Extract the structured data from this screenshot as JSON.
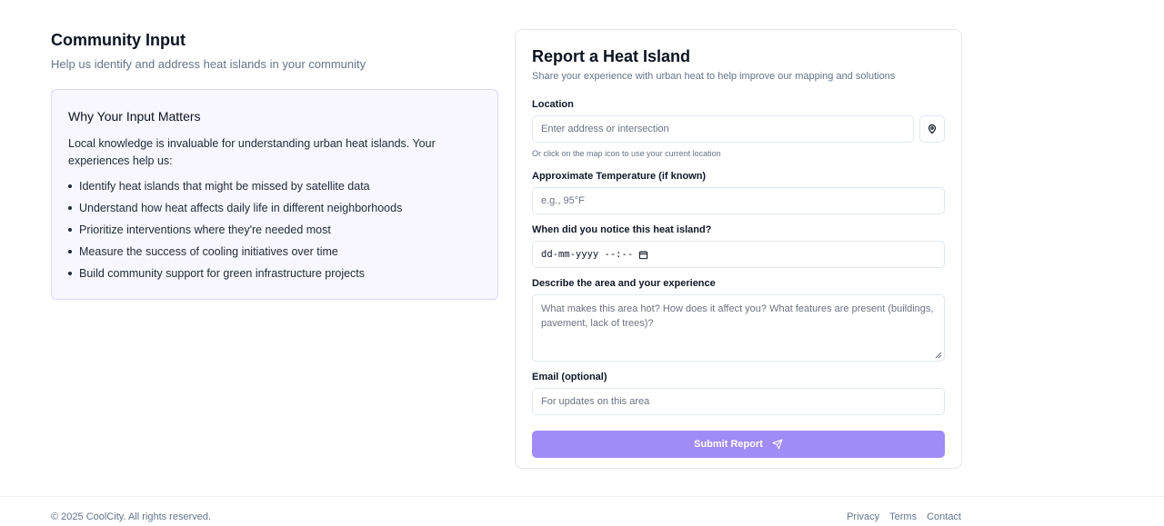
{
  "header": {
    "title": "Community Input",
    "subtitle": "Help us identify and address heat islands in your community"
  },
  "info": {
    "title": "Why Your Input Matters",
    "text": "Local knowledge is invaluable for understanding urban heat islands. Your experiences help us:",
    "items": [
      "Identify heat islands that might be missed by satellite data",
      "Understand how heat affects daily life in different neighborhoods",
      "Prioritize interventions where they're needed most",
      "Measure the success of cooling initiatives over time",
      "Build community support for green infrastructure projects"
    ]
  },
  "form": {
    "title": "Report a Heat Island",
    "subtitle": "Share your experience with urban heat to help improve our mapping and solutions",
    "location_label": "Location",
    "location_placeholder": "Enter address or intersection",
    "location_hint": "Or click on the map icon to use your current location",
    "temp_label": "Approximate Temperature (if known)",
    "temp_placeholder": "e.g., 95°F",
    "date_label": "When did you notice this heat island?",
    "date_placeholder": "dd-mm-yyyy --:--",
    "describe_label": "Describe the area and your experience",
    "describe_placeholder": "What makes this area hot? How does it affect you? What features are present (buildings, pavement, lack of trees)?",
    "email_label": "Email (optional)",
    "email_placeholder": "For updates on this area",
    "submit_label": "Submit Report"
  },
  "footer": {
    "copyright": "© 2025 CoolCity. All rights reserved.",
    "links": [
      "Privacy",
      "Terms",
      "Contact"
    ]
  },
  "colors": {
    "accent": "#a18bf5",
    "card_bg": "#f8f7ff",
    "card_border": "#ddd6fe"
  },
  "icons": {
    "location": "map-pin-icon",
    "calendar": "calendar-icon",
    "submit": "send-icon"
  }
}
